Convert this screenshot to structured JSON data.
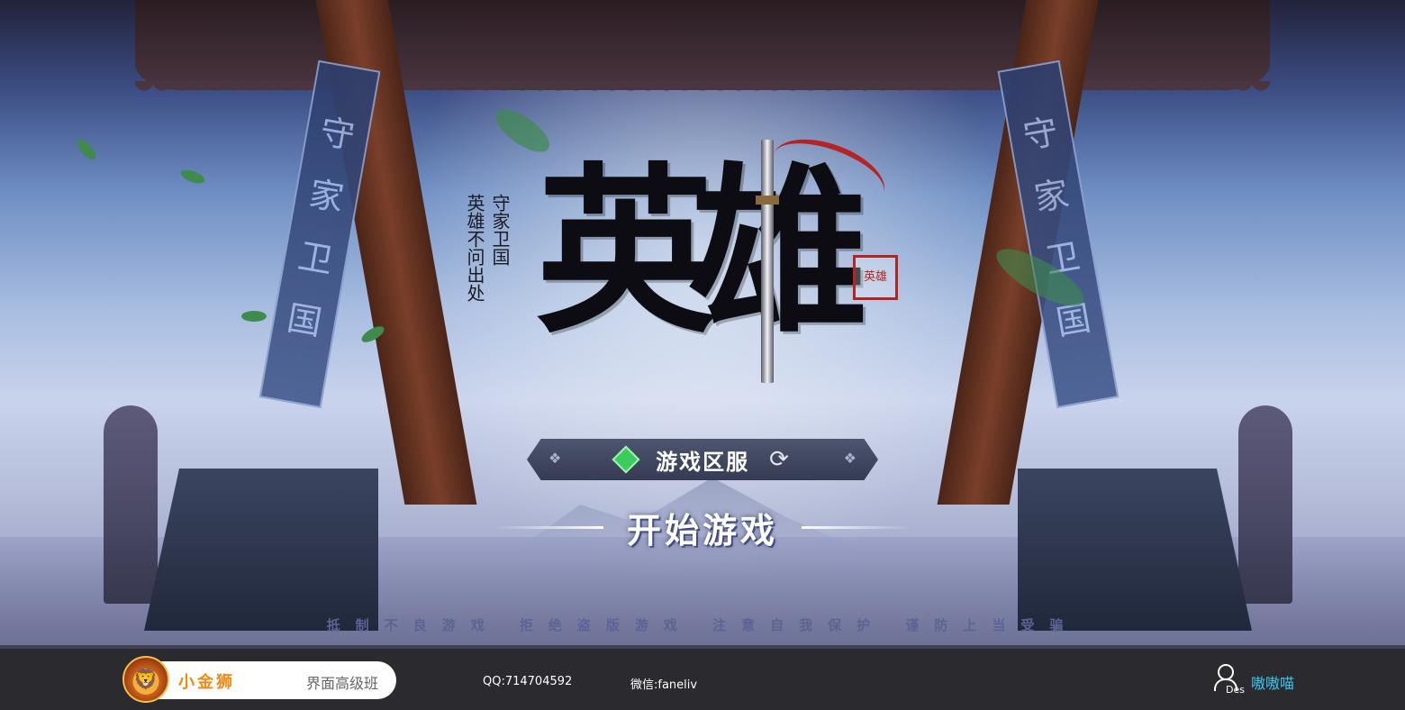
{
  "game": {
    "title": "英雄",
    "subtitle_lines": [
      "守家卫国",
      "英雄不问出处"
    ],
    "seal_text": "英雄"
  },
  "banners": {
    "left": [
      "守",
      "家",
      "卫",
      "国"
    ],
    "right": [
      "守",
      "家",
      "卫",
      "国"
    ]
  },
  "server": {
    "label": "游戏区服",
    "status_color": "#3ccc5c"
  },
  "start_button": {
    "label": "开始游戏"
  },
  "notice": "抵制不良游戏 拒绝盗版游戏 注意自我保护 谨防上当受骗",
  "footer": {
    "brand_name": "小金狮",
    "brand_course": "界面高级班",
    "qq": "QQ:714704592",
    "wechat": "微信:faneliv",
    "user_icon_label": "Des",
    "username": "嗷嗷喵"
  },
  "icons": [
    "lion-logo-icon",
    "user-icon",
    "refresh-icon",
    "diamond-status-icon"
  ]
}
